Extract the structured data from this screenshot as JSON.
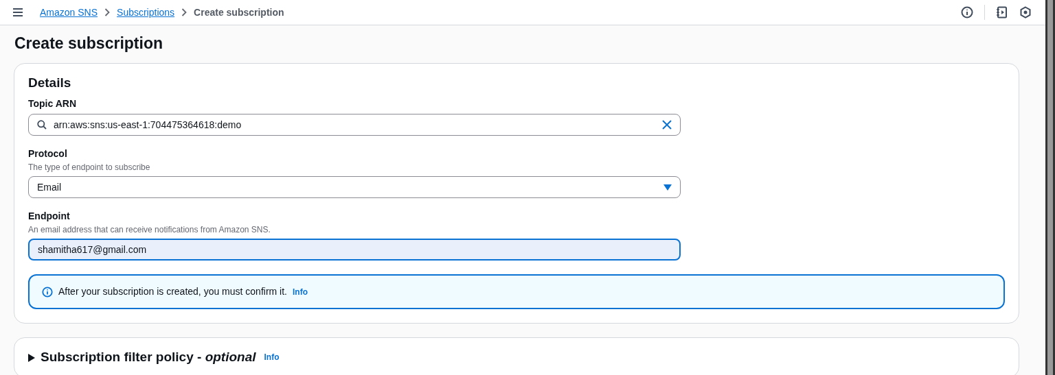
{
  "breadcrumbs": [
    {
      "label": "Amazon SNS",
      "kind": "link"
    },
    {
      "label": "Subscriptions",
      "kind": "link"
    },
    {
      "label": "Create subscription",
      "kind": "current"
    }
  ],
  "page_title": "Create subscription",
  "details": {
    "title": "Details",
    "fields": [
      {
        "kind": "search",
        "label": "Topic ARN",
        "value": "arn:aws:sns:us-east-1:704475364618:demo",
        "focused": false
      },
      {
        "kind": "select",
        "label": "Protocol",
        "description": "The type of endpoint to subscribe",
        "value": "Email",
        "focused": false
      },
      {
        "kind": "text",
        "label": "Endpoint",
        "description": "An email address that can receive notifications from Amazon SNS.",
        "value": "shamitha617@gmail.com",
        "focused": true
      }
    ],
    "alert": {
      "text": "After your subscription is created, you must confirm it.",
      "link": "Info"
    }
  },
  "filter_policy": {
    "title": "Subscription filter policy - ",
    "title_suffix": "optional",
    "link": "Info",
    "expanded": false
  }
}
